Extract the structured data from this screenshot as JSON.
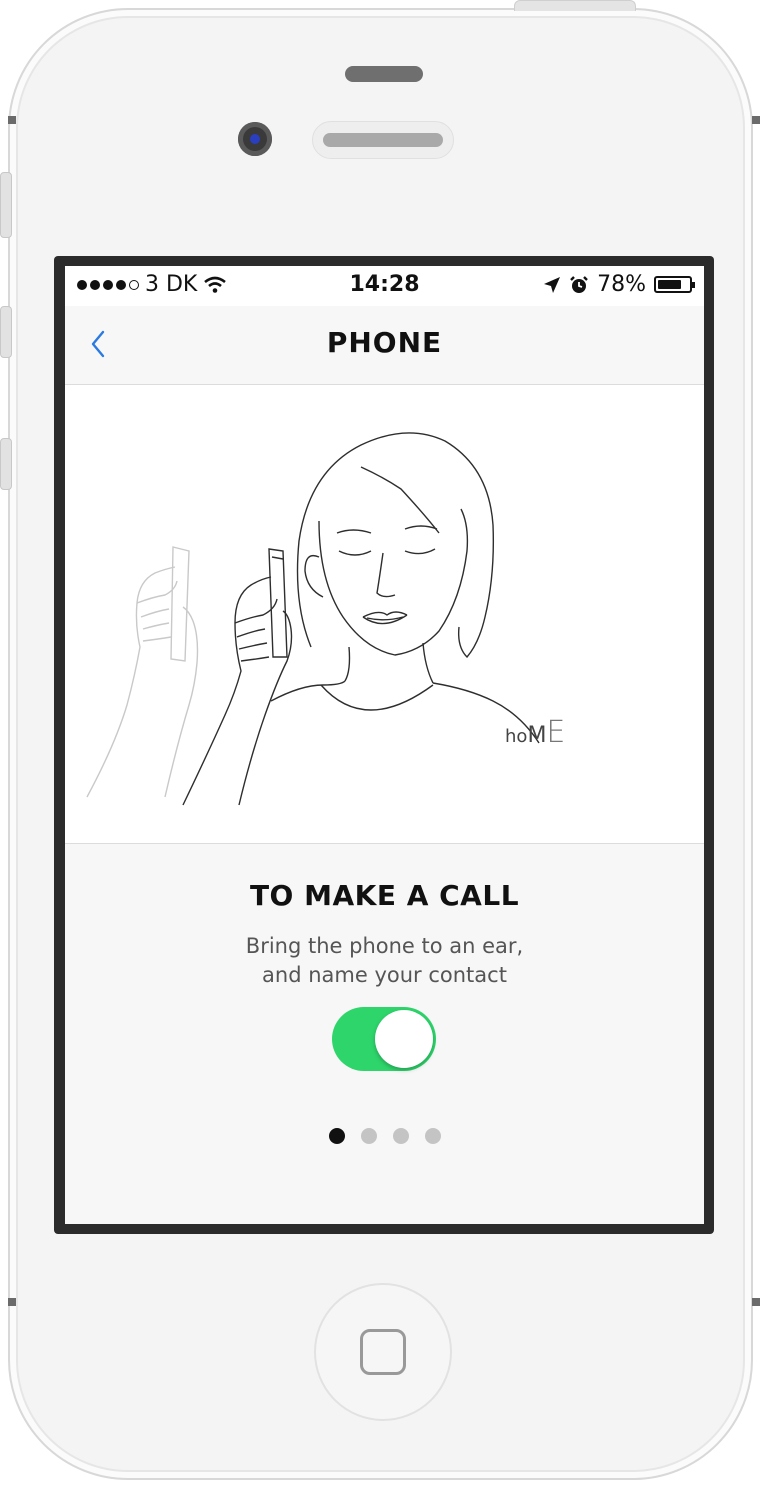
{
  "status_bar": {
    "carrier": "3 DK",
    "signal_bars_filled": 4,
    "signal_bars_total": 5,
    "time": "14:28",
    "battery_percent_label": "78%",
    "battery_level": 0.78
  },
  "nav": {
    "title": "PHONE",
    "back_icon": "chevron-left-icon"
  },
  "illustration": {
    "text_home": {
      "h": "h",
      "o": "o",
      "m": "M",
      "e": "E"
    }
  },
  "panel": {
    "title": "TO MAKE A CALL",
    "description_line1": "Bring the phone to an ear,",
    "description_line2": "and name your contact",
    "toggle_on": true
  },
  "pager": {
    "total": 4,
    "active_index": 0
  },
  "colors": {
    "accent_blue": "#2a7ae2",
    "toggle_green": "#2dd56b",
    "pager_active": "#111111",
    "pager_inactive": "#c4c4c4"
  }
}
